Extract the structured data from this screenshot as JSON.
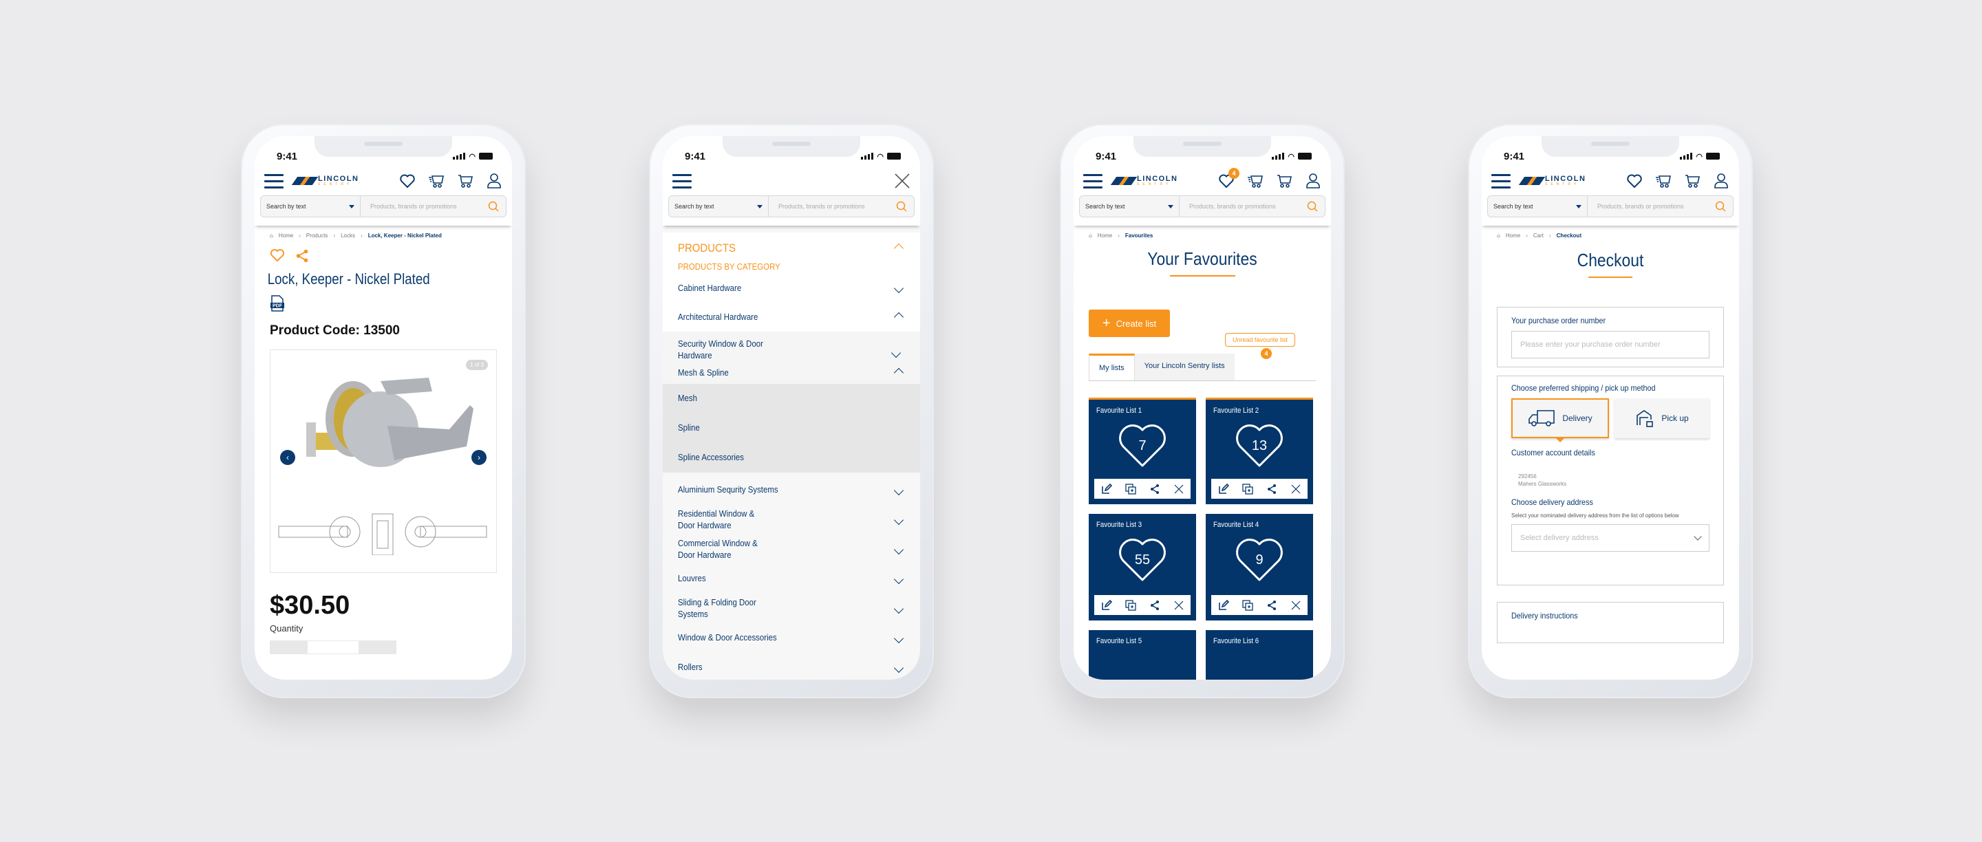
{
  "common": {
    "time": "9:41",
    "brand_name": "LINCOLN",
    "brand_sub": "SENTRY",
    "search_mode": "Search by text",
    "search_placeholder": "Products, brands or promotions",
    "colors": {
      "navy": "#0b3a6e",
      "orange": "#f7941d",
      "card_navy": "#03356a"
    }
  },
  "product_page": {
    "breadcrumb": [
      "Home",
      "Products",
      "Locks",
      "Lock, Keeper - Nickel Plated"
    ],
    "title": "Lock, Keeper - Nickel Plated",
    "pdf_label": "PDF",
    "product_code": "Product Code: 13500",
    "image_counter": "1 of 3",
    "price": "$30.50",
    "quantity_label": "Quantity"
  },
  "menu_page": {
    "section_title": "PRODUCTS",
    "subsection_title": "PRODUCTS BY CATEGORY",
    "items": [
      {
        "label": "Cabinet Hardware",
        "state": "collapsed"
      },
      {
        "label": "Architectural Hardware",
        "state": "expanded"
      },
      {
        "label": "Security Window & Door Hardware",
        "state": "collapsed"
      },
      {
        "label": "Mesh & Spline",
        "state": "expanded"
      },
      {
        "label": "Mesh",
        "state": "child"
      },
      {
        "label": "Spline",
        "state": "child"
      },
      {
        "label": "Spline Accessories",
        "state": "child"
      },
      {
        "label": "Aluminium Sequrity Systems",
        "state": "collapsed"
      },
      {
        "label": "Residential Window & Door Hardware",
        "state": "collapsed"
      },
      {
        "label": "Commercial Window & Door Hardware",
        "state": "collapsed"
      },
      {
        "label": "Louvres",
        "state": "collapsed"
      },
      {
        "label": "Sliding & Folding Door Systems",
        "state": "collapsed"
      },
      {
        "label": "Window & Door Accessories",
        "state": "collapsed"
      },
      {
        "label": "Rollers",
        "state": "collapsed"
      }
    ]
  },
  "favourites_page": {
    "wishlist_badge": "4",
    "breadcrumb": [
      "Home",
      "Favourites"
    ],
    "title": "Your Favourites",
    "create_button": "Create list",
    "tooltip": "Unread favourite list",
    "tab_badge": "4",
    "tabs": [
      "My lists",
      "Your Lincoln Sentry lists"
    ],
    "lists": [
      {
        "name": "Favourite List 1",
        "count": "7"
      },
      {
        "name": "Favourite List 2",
        "count": "13"
      },
      {
        "name": "Favourite List 3",
        "count": "55"
      },
      {
        "name": "Favourite List 4",
        "count": "9"
      },
      {
        "name": "Favourite List 5",
        "count": ""
      },
      {
        "name": "Favourite List 6",
        "count": ""
      }
    ]
  },
  "checkout_page": {
    "breadcrumb": [
      "Home",
      "Cart",
      "Checkout"
    ],
    "title": "Checkout",
    "po_label": "Your purchase order number",
    "po_placeholder": "Please enter your purchase order number",
    "shipping_label": "Choose preferred shipping / pick up method",
    "delivery_option": "Delivery",
    "pickup_option": "Pick up",
    "account_label": "Customer account details",
    "account_number": "292456",
    "account_name": "Mahers Glassworks",
    "address_label": "Choose delivery address",
    "address_hint": "Select your nominated delivery address from the list of options below",
    "address_placeholder": "Select delivery address",
    "instructions_label": "Delivery instructions"
  }
}
